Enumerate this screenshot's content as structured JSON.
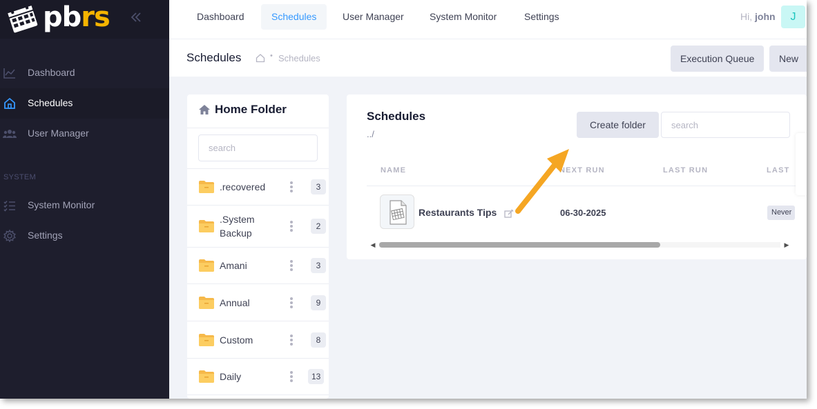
{
  "brand": {
    "logo_pb": "pb",
    "logo_rs": "rs",
    "collapse_icon": "double-chevron-left"
  },
  "sidebar": {
    "items": [
      {
        "label": "Dashboard",
        "icon": "chart-line-icon"
      },
      {
        "label": "Schedules",
        "icon": "home-icon",
        "active": true
      },
      {
        "label": "User Manager",
        "icon": "users-icon"
      }
    ],
    "section": "SYSTEM",
    "system_items": [
      {
        "label": "System Monitor",
        "icon": "list-check-icon"
      },
      {
        "label": "Settings",
        "icon": "gear-icon"
      }
    ]
  },
  "topbar": {
    "tabs": [
      "Dashboard",
      "Schedules",
      "User Manager",
      "System Monitor",
      "Settings"
    ],
    "active_tab": "Schedules",
    "greeting": "Hi,",
    "user": "john",
    "avatar_letter": "J"
  },
  "subheader": {
    "title": "Schedules",
    "breadcrumb": "Schedules",
    "buttons": [
      "Execution Queue",
      "New"
    ]
  },
  "folders": {
    "title": "Home Folder",
    "search_placeholder": "search",
    "items": [
      {
        "name": ".recovered",
        "count": "3"
      },
      {
        "name": ".System Backup",
        "line1": ".System",
        "line2": "Backup",
        "count": "2"
      },
      {
        "name": "Amani",
        "count": "3"
      },
      {
        "name": "Annual",
        "count": "9"
      },
      {
        "name": "Custom",
        "count": "8"
      },
      {
        "name": "Daily",
        "count": "13"
      }
    ]
  },
  "schedules": {
    "title": "Schedules",
    "path": "../",
    "create_folder_label": "Create folder",
    "search_placeholder": "search",
    "columns": [
      "NAME",
      "NEXT RUN",
      "LAST RUN",
      "LAST"
    ],
    "rows": [
      {
        "name": "Restaurants Tips",
        "next_run": "06-30-2025",
        "last_run": "",
        "status": "Never"
      }
    ]
  },
  "colors": {
    "accent": "#3699ff",
    "sidebar_bg": "#1e1e2d",
    "logo_accent": "#f5b400",
    "callout_arrow": "#f5a623"
  }
}
